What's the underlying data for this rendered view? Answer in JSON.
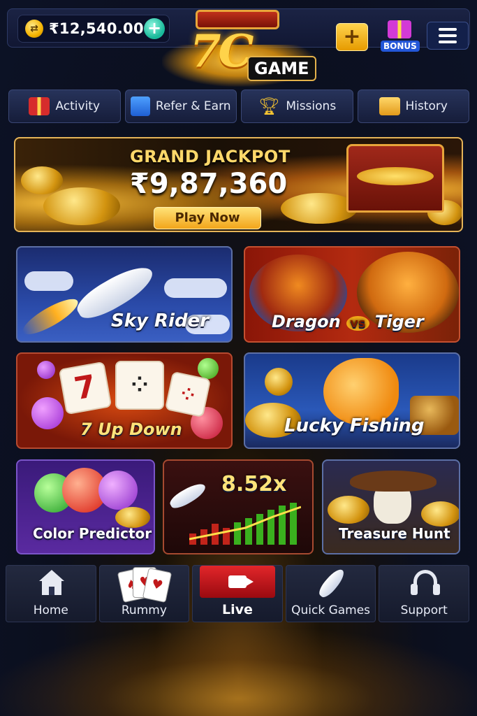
{
  "header": {
    "balance": "₹12,540.00",
    "logo_main": "7C",
    "logo_sub": "GAME",
    "bonus_label": "BONUS"
  },
  "quick_links": [
    {
      "label": "Activity",
      "icon": "gift-icon"
    },
    {
      "label": "Refer & Earn",
      "icon": "shopping-bag-icon"
    },
    {
      "label": "Missions",
      "icon": "trophy-icon"
    },
    {
      "label": "History",
      "icon": "box-icon"
    }
  ],
  "jackpot": {
    "title": "GRAND JACKPOT",
    "amount": "₹9,87,360",
    "button": "Play Now"
  },
  "games": {
    "sky_rider": "Sky Rider",
    "dragon_tiger": {
      "left": "Dragon",
      "vs": "vs",
      "right": "Tiger"
    },
    "seven_up_down": "7 Up Down",
    "lucky_fishing": "Lucky Fishing",
    "color_predictor": "Color Predictor",
    "crash_multiplier": "8.52x",
    "treasure_hunt": "Treasure Hunt"
  },
  "bottom_nav": [
    {
      "label": "Home",
      "icon": "home-icon"
    },
    {
      "label": "Rummy",
      "icon": "playing-cards-icon"
    },
    {
      "label": "Live",
      "icon": "video-camera-icon",
      "active": true
    },
    {
      "label": "Quick Games",
      "icon": "rocket-icon"
    },
    {
      "label": "Support",
      "icon": "headset-icon"
    }
  ],
  "colors": {
    "accent_gold": "#ffd34a",
    "live_red": "#e2262a",
    "background": "#0c1226"
  }
}
